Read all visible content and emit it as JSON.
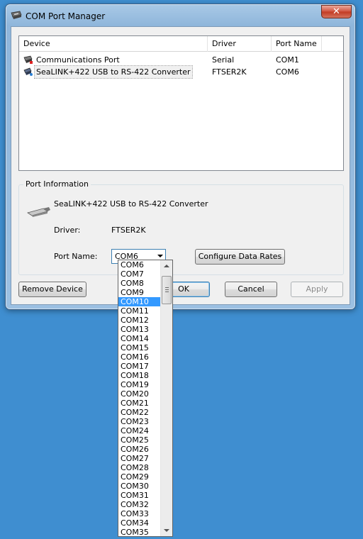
{
  "window": {
    "title": "COM Port Manager",
    "close_label": "✕"
  },
  "devices": {
    "columns": [
      "Device",
      "Driver",
      "Port Name"
    ],
    "rows": [
      {
        "device": "Communications Port",
        "driver": "Serial",
        "port": "COM1",
        "icon": "serial-port-icon"
      },
      {
        "device": "SeaLINK+422 USB to RS-422 Converter",
        "driver": "FTSER2K",
        "port": "COM6",
        "icon": "usb-converter-icon"
      }
    ]
  },
  "port_info": {
    "legend": "Port Information",
    "device_name": "SeaLINK+422 USB to RS-422 Converter",
    "driver_label": "Driver:",
    "driver_value": "FTSER2K",
    "port_name_label": "Port Name:",
    "port_name_value": "COM6",
    "configure_button": "Configure Data Rates",
    "icon": "serial-cable-icon"
  },
  "buttons": {
    "remove": "Remove Device",
    "ok": "OK",
    "cancel": "Cancel",
    "apply": "Apply"
  },
  "dropdown": {
    "selected": "COM10",
    "options": [
      "COM6",
      "COM7",
      "COM8",
      "COM9",
      "COM10",
      "COM11",
      "COM12",
      "COM13",
      "COM14",
      "COM15",
      "COM16",
      "COM17",
      "COM18",
      "COM19",
      "COM20",
      "COM21",
      "COM22",
      "COM23",
      "COM24",
      "COM25",
      "COM26",
      "COM27",
      "COM28",
      "COM29",
      "COM30",
      "COM31",
      "COM32",
      "COM33",
      "COM34",
      "COM35"
    ]
  },
  "colors": {
    "desktop": "#3f8ed0",
    "selection": "#3399ff"
  }
}
